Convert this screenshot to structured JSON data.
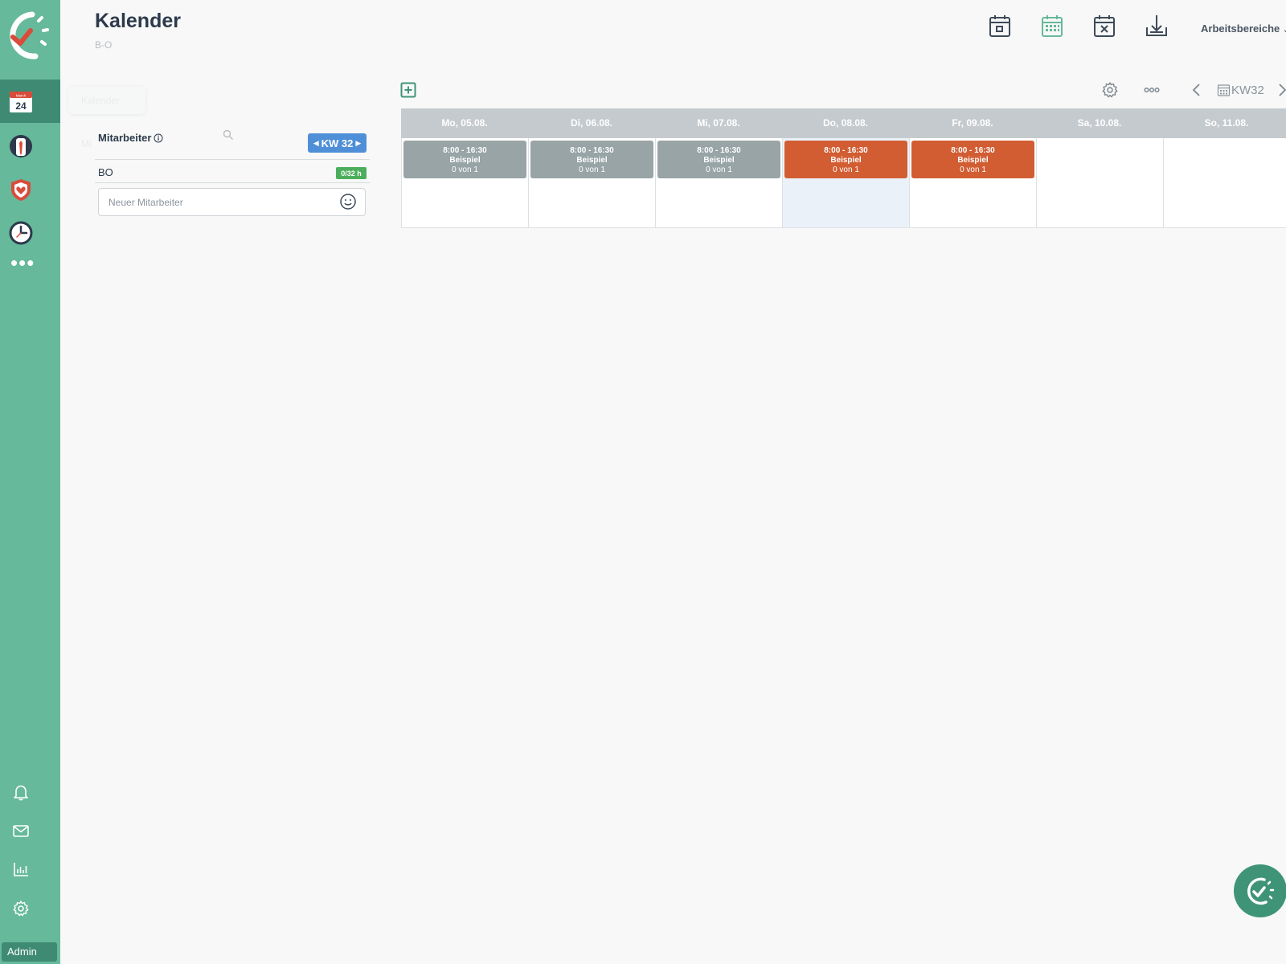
{
  "app": {
    "title": "Kalender",
    "subtitle": "B-O",
    "workspaces_label": "Arbeitsbereiche"
  },
  "sidebar": {
    "calendar_month": "March",
    "calendar_day": "24",
    "admin_label": "Admin",
    "more_label": "•••"
  },
  "ghosts": {
    "calendar": "Kalender",
    "employee": "Mi"
  },
  "employees_panel": {
    "label": "Mitarbeiter",
    "week_badge": "KW 32",
    "rows": [
      {
        "name": "BO",
        "hours": "0/32 h"
      }
    ],
    "new_employee_placeholder": "Neuer Mitarbeiter"
  },
  "calendar": {
    "week_label": "KW32",
    "days": [
      {
        "label": "Mo, 05.08.",
        "today": false,
        "shift": {
          "time": "8:00 - 16:30",
          "name": "Beispiel",
          "count": "0 von 1",
          "status": "gray"
        }
      },
      {
        "label": "Di, 06.08.",
        "today": false,
        "shift": {
          "time": "8:00 - 16:30",
          "name": "Beispiel",
          "count": "0 von 1",
          "status": "gray"
        }
      },
      {
        "label": "Mi, 07.08.",
        "today": false,
        "shift": {
          "time": "8:00 - 16:30",
          "name": "Beispiel",
          "count": "0 von 1",
          "status": "gray"
        }
      },
      {
        "label": "Do, 08.08.",
        "today": true,
        "shift": {
          "time": "8:00 - 16:30",
          "name": "Beispiel",
          "count": "0 von 1",
          "status": "orange"
        }
      },
      {
        "label": "Fr, 09.08.",
        "today": false,
        "shift": {
          "time": "8:00 - 16:30",
          "name": "Beispiel",
          "count": "0 von 1",
          "status": "orange"
        }
      },
      {
        "label": "Sa, 10.08.",
        "today": false,
        "shift": null
      },
      {
        "label": "So, 11.08.",
        "today": false,
        "shift": null
      }
    ]
  },
  "colors": {
    "sidebar": "#66b99b",
    "sidebar_active": "#3f8a73",
    "shift_gray": "#98a4a6",
    "shift_orange": "#d25d33",
    "kw_badge": "#4f8fd8",
    "hours_badge": "#4cae5c",
    "today_cell": "#eaf1f8"
  },
  "icons": [
    "logo-icon",
    "calendar-icon",
    "tie-icon",
    "shield-heart-icon",
    "clock-icon",
    "bell-icon",
    "mail-icon",
    "chart-icon",
    "gear-icon",
    "calendar-day-icon",
    "calendar-grid-icon",
    "calendar-x-icon",
    "download-icon",
    "plus-square-icon",
    "search-icon",
    "info-icon",
    "smiley-icon",
    "chevron-left-icon",
    "chevron-right-icon",
    "chevron-down-icon",
    "more-icon"
  ]
}
